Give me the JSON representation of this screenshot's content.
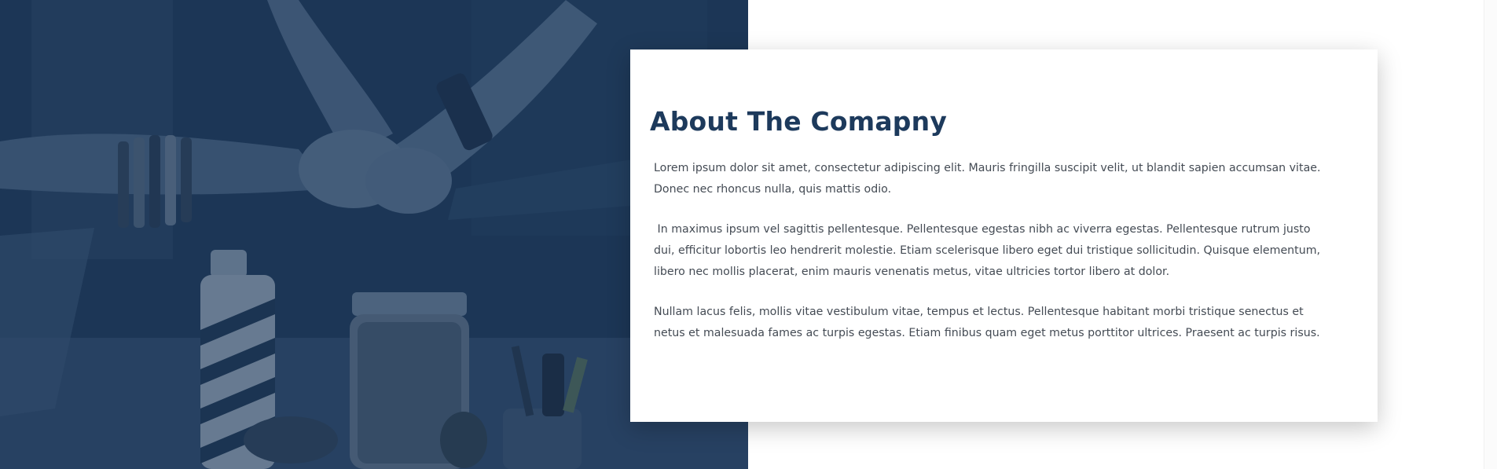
{
  "about": {
    "title": "About The Comapny",
    "paragraphs": [
      "Lorem ipsum dolor sit amet, consectetur adipiscing elit. Mauris fringilla suscipit velit, ut blandit sapien accumsan vitae. Donec nec rhoncus nulla, quis mattis odio.",
      " In maximus ipsum vel sagittis pellentesque. Pellentesque egestas nibh ac viverra egestas. Pellentesque rutrum justo dui, efficitur lobortis leo hendrerit molestie. Etiam scelerisque libero eget dui tristique sollicitudin. Quisque elementum, libero nec mollis placerat, enim mauris venenatis metus, vitae ultricies tortor libero at dolor.",
      "Nullam lacus felis, mollis vitae vestibulum vitae, tempus et lectus. Pellentesque habitant morbi tristique senectus et netus et malesuada fames ac turpis egestas. Etiam finibus quam eget metus porttitor ultrices. Praesent ac turpis risus."
    ]
  },
  "hero": {
    "image_subject": "team-fist-bump-photo",
    "tint_color": "#1c3450"
  },
  "colors": {
    "title": "#1d3a5c",
    "body_text": "#444b54",
    "card_background": "#ffffff"
  }
}
